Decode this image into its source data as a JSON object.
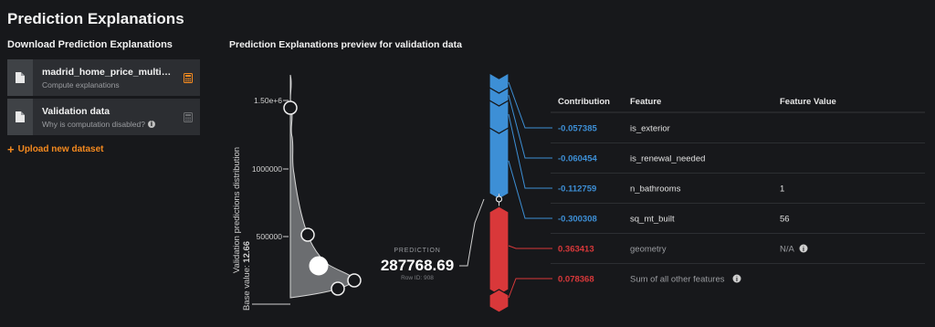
{
  "page": {
    "title": "Prediction Explanations"
  },
  "download": {
    "title": "Download Prediction Explanations",
    "items": [
      {
        "name": "madrid_home_price_multimo...",
        "subtitle": "Compute explanations",
        "action_icon": "calculator-icon",
        "action_color": "#f58a1f"
      },
      {
        "name": "Validation data",
        "subtitle": "Why is computation disabled?",
        "action_icon": "calculator-icon",
        "action_color": "#6b6d70"
      }
    ],
    "upload_label": "Upload new dataset"
  },
  "preview": {
    "title": "Prediction Explanations preview for validation data",
    "distribution": {
      "axis_label": "Validation predictions distribution",
      "ticks": [
        "1.50e+6",
        "1000000",
        "500000"
      ],
      "base_label": "Base value:",
      "base_value": "12.66"
    },
    "prediction": {
      "label": "PREDICTION",
      "value": "287768.69",
      "row_id": "Row ID: 908"
    },
    "table": {
      "headers": {
        "contribution": "Contribution",
        "feature": "Feature",
        "value": "Feature Value"
      },
      "rows": [
        {
          "contribution": "-0.057385",
          "feature": "is_exterior",
          "value": "",
          "sign": "negative",
          "info": false
        },
        {
          "contribution": "-0.060454",
          "feature": "is_renewal_needed",
          "value": "",
          "sign": "negative",
          "info": false
        },
        {
          "contribution": "-0.112759",
          "feature": "n_bathrooms",
          "value": "1",
          "sign": "negative",
          "info": false
        },
        {
          "contribution": "-0.300308",
          "feature": "sq_mt_built",
          "value": "56",
          "sign": "negative",
          "info": false
        },
        {
          "contribution": "0.363413",
          "feature": "geometry",
          "value": "N/A",
          "sign": "positive",
          "info": true
        },
        {
          "contribution": "0.078368",
          "feature": "Sum of all other features",
          "value": "",
          "sign": "positive",
          "info": true
        }
      ]
    },
    "colors": {
      "negative": "#3d8fd6",
      "positive": "#d9383a",
      "accent": "#f58a1f"
    }
  }
}
